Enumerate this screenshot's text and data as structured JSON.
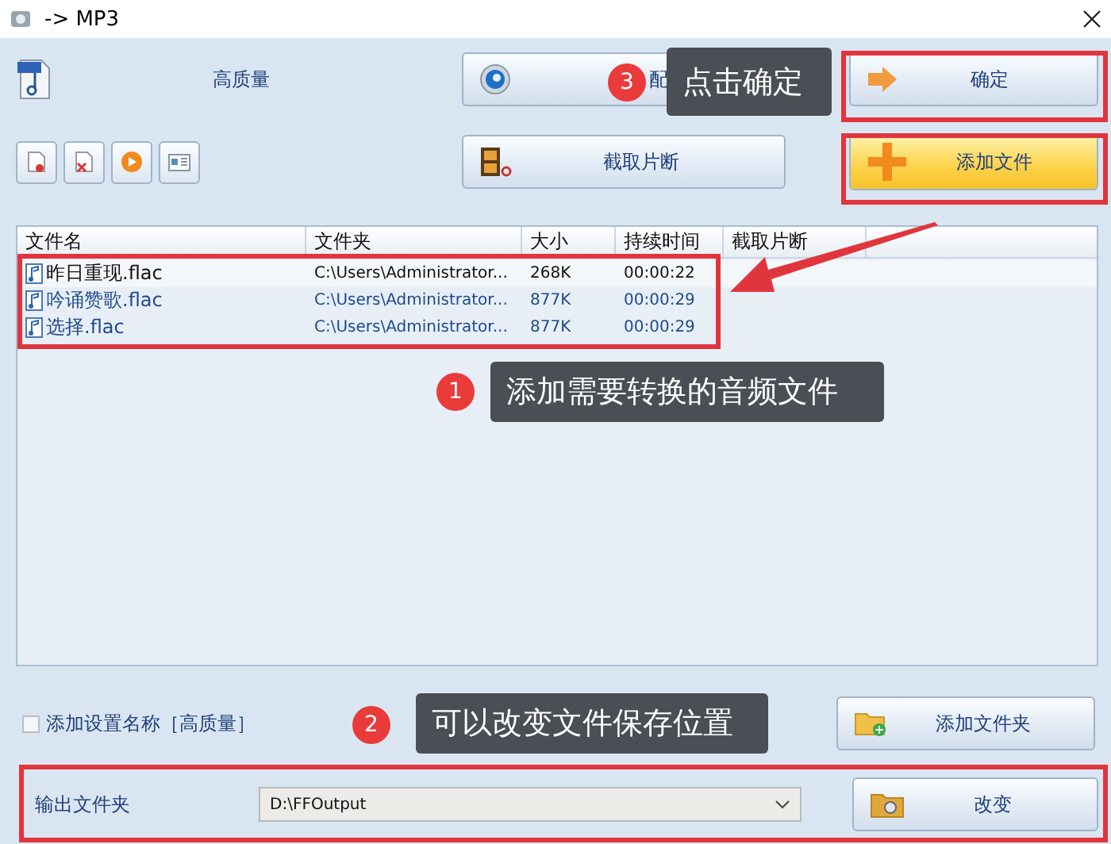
{
  "window": {
    "title": "-> MP3"
  },
  "preset": {
    "label": "高质量"
  },
  "buttons": {
    "config": "配",
    "ok": "确定",
    "clip": "截取片断",
    "add_file": "添加文件",
    "add_folder": "添加文件夹",
    "change": "改变"
  },
  "table": {
    "columns": [
      "文件名",
      "文件夹",
      "大小",
      "持续时间",
      "截取片断"
    ],
    "rows": [
      {
        "name": "昨日重现.flac",
        "folder": "C:\\Users\\Administrator...",
        "size": "268K",
        "duration": "00:00:22",
        "selected": true
      },
      {
        "name": "吟诵赞歌.flac",
        "folder": "C:\\Users\\Administrator...",
        "size": "877K",
        "duration": "00:00:29",
        "selected": false
      },
      {
        "name": "选择.flac",
        "folder": "C:\\Users\\Administrator...",
        "size": "877K",
        "duration": "00:00:29",
        "selected": false
      }
    ]
  },
  "add_name": {
    "label": "添加设置名称［高质量］",
    "checked": false
  },
  "output": {
    "label": "输出文件夹",
    "value": "D:\\FFOutput"
  },
  "callouts": [
    {
      "number": "3",
      "text": "点击确定"
    },
    {
      "number": "1",
      "text": "添加需要转换的音频文件"
    },
    {
      "number": "2",
      "text": "可以改变文件保存位置"
    }
  ]
}
